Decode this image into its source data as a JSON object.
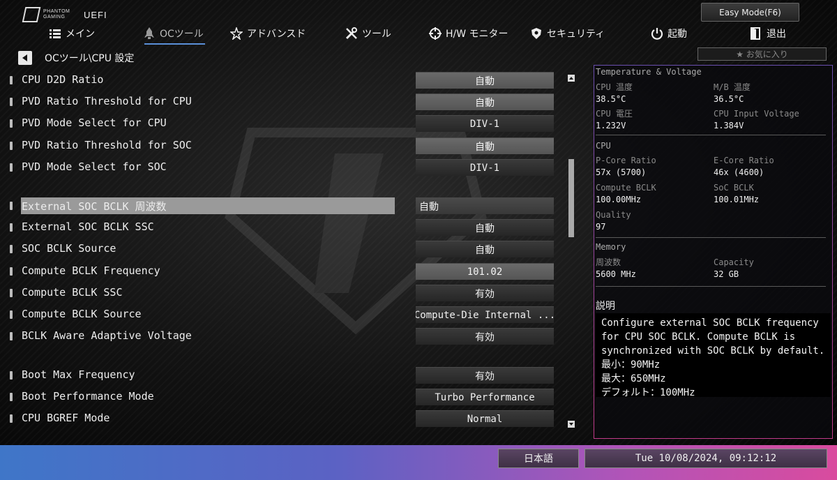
{
  "header": {
    "brand_line1": "PHANTOM",
    "brand_line2": "GAMING",
    "uefi": "UEFI",
    "easy_mode": "Easy Mode(F6)"
  },
  "nav": [
    {
      "label": "メイン",
      "icon": "list-icon"
    },
    {
      "label": "OCツール",
      "icon": "rocket-icon"
    },
    {
      "label": "アドバンスド",
      "icon": "star-icon"
    },
    {
      "label": "ツール",
      "icon": "tools-icon"
    },
    {
      "label": "H/W モニター",
      "icon": "crosshair-icon"
    },
    {
      "label": "セキュリティ",
      "icon": "shield-icon"
    },
    {
      "label": "起動",
      "icon": "power-icon"
    },
    {
      "label": "退出",
      "icon": "exit-icon"
    }
  ],
  "breadcrumb": "OCツール\\CPU 設定",
  "favorites": "★ お気に入り",
  "settings": [
    {
      "label": "CPU D2D Ratio",
      "value": "自動"
    },
    {
      "label": "PVD Ratio Threshold for CPU",
      "value": "自動"
    },
    {
      "label": "PVD Mode Select for CPU",
      "value": "DIV-1"
    },
    {
      "label": "PVD Ratio Threshold for SOC",
      "value": "自動"
    },
    {
      "label": "PVD Mode Select for SOC",
      "value": "DIV-1"
    },
    {
      "label": "External SOC BCLK 周波数",
      "value": "自動"
    },
    {
      "label": "External SOC BCLK SSC",
      "value": "自動"
    },
    {
      "label": "SOC BCLK Source",
      "value": "自動"
    },
    {
      "label": "Compute BCLK Frequency",
      "value": "101.02"
    },
    {
      "label": "Compute BCLK SSC",
      "value": "有効"
    },
    {
      "label": "Compute BCLK Source",
      "value": "Compute-Die Internal ..."
    },
    {
      "label": "BCLK Aware Adaptive Voltage",
      "value": "有効"
    },
    {
      "label": "Boot Max Frequency",
      "value": "有効"
    },
    {
      "label": "Boot Performance Mode",
      "value": "Turbo Performance"
    },
    {
      "label": "CPU BGREF Mode",
      "value": "Normal"
    }
  ],
  "monitor": {
    "tv_title": "Temperature & Voltage",
    "cpu_temp_label": "CPU 温度",
    "cpu_temp": "38.5°C",
    "mb_temp_label": "M/B 温度",
    "mb_temp": "36.5°C",
    "cpu_volt_label": "CPU 電圧",
    "cpu_volt": "1.232V",
    "cpu_input_label": "CPU Input Voltage",
    "cpu_input": "1.384V",
    "cpu_title": "CPU",
    "pcore_label": "P-Core Ratio",
    "pcore": "57x (5700)",
    "ecore_label": "E-Core Ratio",
    "ecore": "46x (4600)",
    "cbclk_label": "Compute BCLK",
    "cbclk": "100.00MHz",
    "sbclk_label": "SoC BCLK",
    "sbclk": "100.01MHz",
    "quality_label": "Quality",
    "quality": "97",
    "mem_title": "Memory",
    "freq_label": "周波数",
    "freq": "5600 MHz",
    "cap_label": "Capacity",
    "cap": "32 GB"
  },
  "description": {
    "title": "説明",
    "lines": [
      "Configure external SOC BCLK frequency",
      "for CPU SOC BCLK. Compute BCLK is",
      "synchronized with SOC BCLK by default.",
      "最小：90MHz",
      "最大：650MHz",
      "デフォルト：100MHz"
    ]
  },
  "footer": {
    "language": "日本語",
    "datetime": "Tue 10/08/2024, 09:12:12"
  },
  "colors": {
    "accent": "#5a8fd8",
    "panel_border_top": "#6b4fb0",
    "panel_border_bottom": "#c23b8a"
  }
}
